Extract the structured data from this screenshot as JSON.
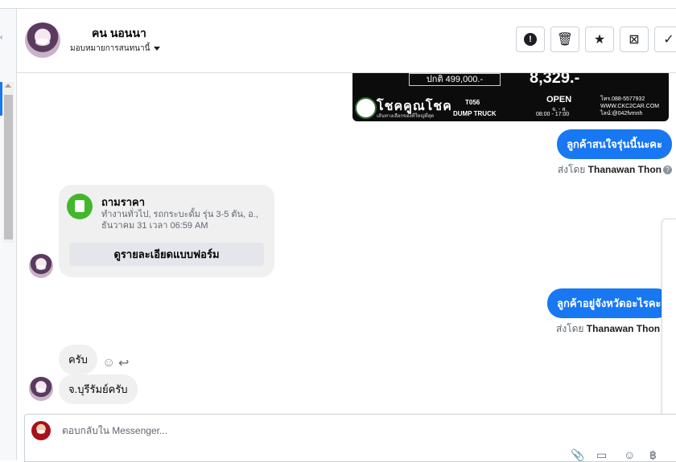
{
  "conversation": {
    "name": "คน นอนนา",
    "assign_label": "มอบหมายการสนทนานี้"
  },
  "header_actions": [
    {
      "name": "spam-report-button",
      "glyph": "!"
    },
    {
      "name": "delete-button",
      "glyph": "🗑"
    },
    {
      "name": "star-button",
      "glyph": "★"
    },
    {
      "name": "archive-button",
      "glyph": "⊠"
    },
    {
      "name": "done-button",
      "glyph": "✓"
    }
  ],
  "ad_image": {
    "regular_price": "ปกติ 499,000.-",
    "sale_price": "8,329.-",
    "brand": "โชคคูณโชค",
    "brand_sub": "เส้นทางเลือกของที่ใหญ่ที่สุด",
    "code": "T056",
    "model": "DUMP TRUCK",
    "open": "OPEN",
    "days": "จ. - ส.",
    "hours": "08:00 - 17:00",
    "contact": [
      "โทร.088-5577932",
      "WWW.CKC2CAR.COM",
      "ไลน์:@042fvmnh"
    ]
  },
  "messages": {
    "out1": "ลูกค้าสนใจรุ่นนี้นะคะ",
    "sent_by_1": {
      "prefix": "ส่งโดย",
      "name": "Thanawan Thon"
    },
    "form": {
      "title": "ถามราคา",
      "desc": "ทำงานทั่วไป, รถกระบะดั้ม รุ่น 3-5 ตัน, อ., ธันวาคม 31 เวลา 06:59 AM",
      "button": "ดูรายละเอียดแบบฟอร์ม"
    },
    "out2": "ลูกค้าอยู่จังหวัดอะไรคะ",
    "sent_by_2": {
      "prefix": "ส่งโดย",
      "name": "Thanawan Thon"
    },
    "in1": "ครับ",
    "in2": "จ.บุรีรัมย์ครับ"
  },
  "composer": {
    "placeholder": "ตอบกลับใน Messenger..."
  },
  "colors": {
    "accent": "#1877f2",
    "incoming": "#f0f0f0"
  }
}
